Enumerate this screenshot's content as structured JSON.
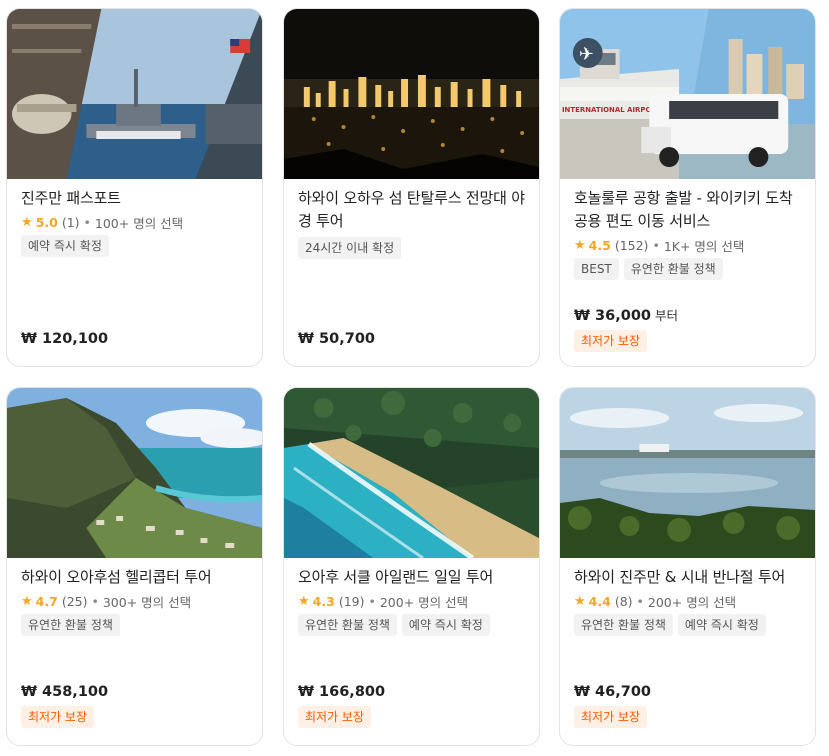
{
  "currency": "₩",
  "cards": [
    {
      "title": "진주만 패스포트",
      "rating": {
        "score": "5.0",
        "count": "(1)",
        "chosen": "100+ 명의 선택"
      },
      "tags": [
        "예약 즉시 확정"
      ],
      "price": "₩ 120,100",
      "price_suffix": "",
      "badge": ""
    },
    {
      "title": "하와이 오하우 섬 탄탈루스 전망대 야경 투어",
      "rating": null,
      "tags": [
        "24시간 이내 확정"
      ],
      "price": "₩ 50,700",
      "price_suffix": "",
      "badge": ""
    },
    {
      "title": "호놀룰루 공항 출발 - 와이키키 도착 공용 편도 이동 서비스",
      "rating": {
        "score": "4.5",
        "count": "(152)",
        "chosen": "1K+ 명의 선택"
      },
      "tags": [
        "BEST",
        "유연한 환불 정책"
      ],
      "price": "₩ 36,000",
      "price_suffix": "부터",
      "badge": "최저가 보장",
      "image_text": "INTERNATIONAL AIRPORT"
    },
    {
      "title": "하와이 오아후섬 헬리콥터 투어",
      "rating": {
        "score": "4.7",
        "count": "(25)",
        "chosen": "300+ 명의 선택"
      },
      "tags": [
        "유연한 환불 정책"
      ],
      "price": "₩ 458,100",
      "price_suffix": "",
      "badge": "최저가 보장"
    },
    {
      "title": "오아후 서클 아일랜드 일일 투어",
      "rating": {
        "score": "4.3",
        "count": "(19)",
        "chosen": "200+ 명의 선택"
      },
      "tags": [
        "유연한 환불 정책",
        "예약 즉시 확정"
      ],
      "price": "₩ 166,800",
      "price_suffix": "",
      "badge": "최저가 보장"
    },
    {
      "title": "하와이 진주만 & 시내 반나절 투어",
      "rating": {
        "score": "4.4",
        "count": "(8)",
        "chosen": "200+ 명의 선택"
      },
      "tags": [
        "유연한 환불 정책",
        "예약 즉시 확정"
      ],
      "price": "₩ 46,700",
      "price_suffix": "",
      "badge": "최저가 보장"
    }
  ],
  "colors": {
    "rating": "#f5a623",
    "badge_text": "#ff5a00",
    "badge_bg": "#fff0e6",
    "tag_bg": "#f2f2f2"
  }
}
